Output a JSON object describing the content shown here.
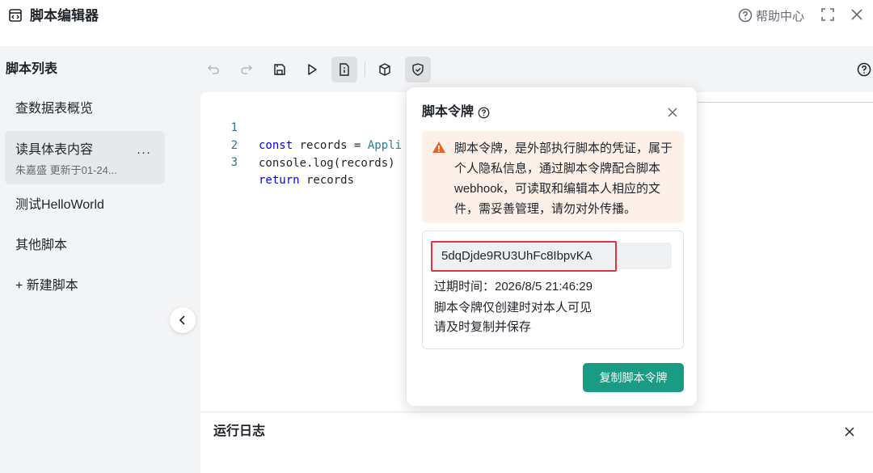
{
  "window": {
    "title": "脚本编辑器",
    "help_label": "帮助中心"
  },
  "sidebar": {
    "title": "脚本列表",
    "items": [
      {
        "label": "查数据表概览",
        "meta": "",
        "active": false
      },
      {
        "label": "读具体表内容",
        "meta": "朱嘉盛 更新于01-24...",
        "active": true
      },
      {
        "label": "测试HelloWorld",
        "meta": "",
        "active": false
      },
      {
        "label": "其他脚本",
        "meta": "",
        "active": false
      }
    ],
    "more_label": "···",
    "new_script_label": "+ 新建脚本"
  },
  "toolbar": {
    "tools": [
      "undo-icon",
      "redo-icon",
      "save-icon",
      "run-icon",
      "token-icon",
      "package-icon",
      "shield-icon"
    ],
    "active_tool": "token-icon",
    "help_icon": "question-icon"
  },
  "editor": {
    "lines": [
      {
        "number": "1",
        "tokens": [
          {
            "t": "const",
            "k": "kw"
          },
          {
            "t": " records = ",
            "k": ""
          },
          {
            "t": "Appli",
            "k": "cls"
          }
        ]
      },
      {
        "number": "2",
        "tokens": [
          {
            "t": "console.log(records)",
            "k": ""
          }
        ]
      },
      {
        "number": "3",
        "tokens": [
          {
            "t": "return",
            "k": "kw"
          },
          {
            "t": " records",
            "k": ""
          }
        ]
      }
    ]
  },
  "log": {
    "title": "运行日志"
  },
  "token_popover": {
    "title": "脚本令牌",
    "warning": "脚本令牌，是外部执行脚本的凭证，属于个人隐私信息，通过脚本令牌配合脚本webhook，可读取和编辑本人相应的文件，需妥善管理，请勿对外传播。",
    "token": "5dqDjde9RU3UhFc8IbpvKA",
    "expiry": "过期时间：2026/8/5 21:46:29",
    "note_1": "脚本令牌仅创建时对本人可见",
    "note_2": "请及时复制并保存",
    "copy_button": "复制脚本令牌"
  },
  "colors": {
    "accent": "#1a9b84",
    "warning_bg": "#fdf0e8",
    "warning_icon": "#e8622c",
    "token_highlight": "#d9363e"
  }
}
